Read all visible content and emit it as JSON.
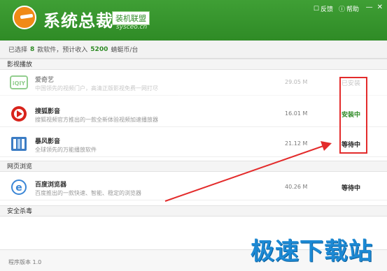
{
  "header": {
    "brand": "系统总裁",
    "badge": "装机联盟",
    "url": "sysceo.cn",
    "links": [
      {
        "icon": "feedback-icon",
        "label": "反馈"
      },
      {
        "icon": "help-icon",
        "label": "帮助"
      }
    ],
    "window_buttons": [
      "minimize-icon",
      "close-icon"
    ]
  },
  "summary": {
    "prefix": "已选择",
    "count": "8",
    "mid": "款软件，预计收入",
    "income": "5200",
    "unit": "蜻蜓币/台"
  },
  "sections": [
    {
      "title": "影视播放",
      "items": [
        {
          "name": "爱奇艺",
          "desc": "中国领先的视频门户，高清正版影视免费一网打尽",
          "size": "29.05 M",
          "status": "已安装",
          "status_type": "done",
          "icon": "iqiyi-icon",
          "dim": true
        },
        {
          "name": "搜狐影音",
          "desc": "搜狐视频官方推出的一款全新体验视频加速播放器",
          "size": "16.01 M",
          "status": "安装中",
          "status_type": "installing",
          "icon": "sohu-video-icon",
          "dim": false
        },
        {
          "name": "暴风影音",
          "desc": "全球领先的万能播放软件",
          "size": "21.12 M",
          "status": "等待中",
          "status_type": "waiting",
          "icon": "baofeng-icon",
          "dim": false
        }
      ]
    },
    {
      "title": "网页浏览",
      "items": [
        {
          "name": "百度浏览器",
          "desc": "百度推出的一款快速、智能、稳定的浏览器",
          "size": "40.26 M",
          "status": "等待中",
          "status_type": "waiting",
          "icon": "baidu-browser-icon",
          "dim": false
        }
      ]
    },
    {
      "title": "安全杀毒",
      "items": []
    }
  ],
  "footer": {
    "version": "程序版本 1.0"
  },
  "watermark": "极速下载站",
  "colors": {
    "brand_green": "#2f8b26",
    "highlight_red": "#e32b2b",
    "watermark_blue": "#1c89d4"
  }
}
